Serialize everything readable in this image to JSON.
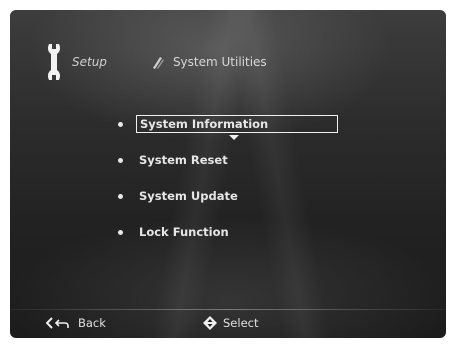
{
  "header": {
    "section_label": "Setup",
    "page_title": "System Utilities"
  },
  "menu": {
    "items": [
      {
        "label": "System Information",
        "selected": true
      },
      {
        "label": "System Reset",
        "selected": false
      },
      {
        "label": "System Update",
        "selected": false
      },
      {
        "label": "Lock Function",
        "selected": false
      }
    ]
  },
  "footer": {
    "back_label": "Back",
    "select_label": "Select"
  },
  "colors": {
    "text": "#e6e6e6",
    "highlight_border": "#f0f0f0",
    "background": "#2a2a2a"
  }
}
